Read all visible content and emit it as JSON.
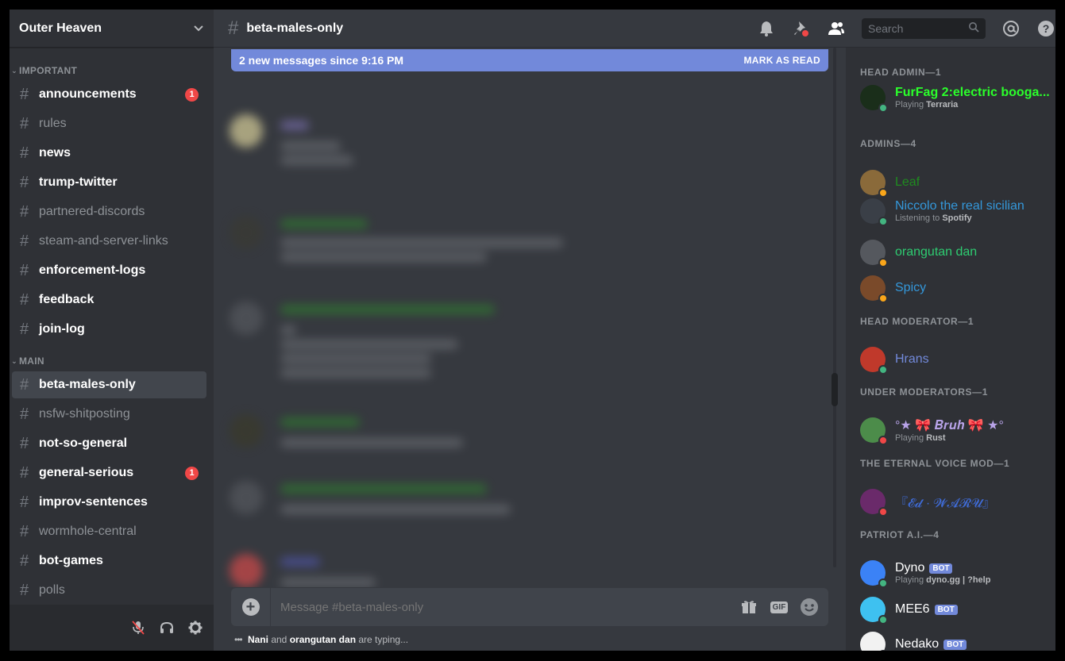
{
  "server": {
    "name": "Outer Heaven"
  },
  "categories": [
    {
      "label": "IMPORTANT"
    },
    {
      "label": "MAIN"
    }
  ],
  "channels": [
    {
      "name": "announcements",
      "state": "unread",
      "badge": "1"
    },
    {
      "name": "rules",
      "state": "muted"
    },
    {
      "name": "news",
      "state": "unread"
    },
    {
      "name": "trump-twitter",
      "state": "unread"
    },
    {
      "name": "partnered-discords",
      "state": "muted"
    },
    {
      "name": "steam-and-server-links",
      "state": "muted"
    },
    {
      "name": "enforcement-logs",
      "state": "unread"
    },
    {
      "name": "feedback",
      "state": "unread"
    },
    {
      "name": "join-log",
      "state": "unread"
    },
    {
      "name": "beta-males-only",
      "state": "selected"
    },
    {
      "name": "nsfw-shitposting",
      "state": "muted"
    },
    {
      "name": "not-so-general",
      "state": "unread"
    },
    {
      "name": "general-serious",
      "state": "unread",
      "badge": "1"
    },
    {
      "name": "improv-sentences",
      "state": "unread"
    },
    {
      "name": "wormhole-central",
      "state": "muted"
    },
    {
      "name": "bot-games",
      "state": "unread"
    },
    {
      "name": "polls",
      "state": "muted"
    }
  ],
  "header": {
    "channel": "beta-males-only",
    "search_placeholder": "Search"
  },
  "banner": {
    "text": "2 new messages since 9:16 PM",
    "action": "MARK AS READ"
  },
  "composer": {
    "placeholder": "Message #beta-males-only"
  },
  "typing": {
    "user1": "Nani",
    "and": "and",
    "user2": "orangutan dan",
    "suffix": "are typing..."
  },
  "members": {
    "roles": [
      "HEAD ADMIN—1",
      "ADMINS—4",
      "HEAD MODERATOR—1",
      "UNDER MODERATORS—1",
      "THE ETERNAL VOICE MOD—1",
      "PATRIOT A.I.—4"
    ],
    "list": [
      {
        "name": "FurFag 2:electric booga...",
        "color": "#2bff2b",
        "status": "online",
        "activity_prefix": "Playing",
        "activity": "Terraria",
        "avatar": "#1a2e1a",
        "bold": true
      },
      {
        "name": "Leaf",
        "color": "#1f8b1f",
        "status": "idle",
        "avatar": "#8a6a3a"
      },
      {
        "name": "Niccolo the real sicilian",
        "color": "#3498db",
        "status": "online",
        "activity_prefix": "Listening to",
        "activity": "Spotify",
        "avatar": "#3a3f47"
      },
      {
        "name": "orangutan dan",
        "color": "#2ecc71",
        "status": "idle",
        "avatar": "#55585e"
      },
      {
        "name": "Spicy",
        "color": "#3498db",
        "status": "idle",
        "avatar": "#7a4a2a"
      },
      {
        "name": "Hrans",
        "color": "#7289da",
        "status": "online",
        "avatar": "#c0392b"
      },
      {
        "name": "°★ 🎀 𝑩𝒓𝒖𝒉 🎀 ★°",
        "color": "#b8a3e8",
        "status": "dnd",
        "activity_prefix": "Playing",
        "activity": "Rust",
        "avatar": "#4c8c4a"
      },
      {
        "name": "『𝓔𝓭 · 𝓦𝓐𝓡𝓤』",
        "color": "#3f6bd6",
        "status": "dnd",
        "avatar": "#6a2a6a"
      },
      {
        "name": "Dyno",
        "color": "#ffffff",
        "status": "online",
        "activity_prefix": "Playing",
        "activity": "dyno.gg | ?help",
        "avatar": "#3b82f6",
        "bot": "BOT"
      },
      {
        "name": "MEE6",
        "color": "#ffffff",
        "status": "online",
        "avatar": "#3ec1f0",
        "bot": "BOT"
      },
      {
        "name": "Nedako",
        "color": "#ffffff",
        "status": "online",
        "avatar": "#f2f2f2",
        "bot": "BOT"
      }
    ]
  }
}
